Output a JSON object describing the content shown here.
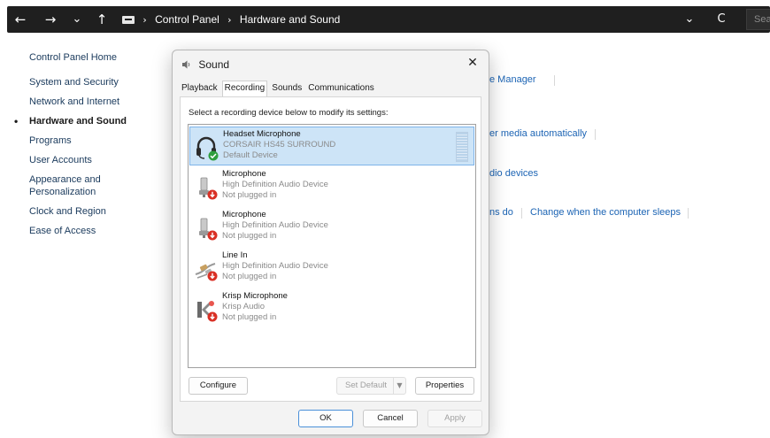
{
  "address_bar": {
    "back_icon": "←",
    "forward_icon": "→",
    "recent_icon": "⌄",
    "up_icon": "↑",
    "crumb_sep": "›",
    "crumbs": [
      "Control Panel",
      "Hardware and Sound"
    ],
    "dropdown_icon": "⌄",
    "refresh_icon": "C",
    "search_placeholder": "Search"
  },
  "sidebar": {
    "items": [
      {
        "label": "Control Panel Home"
      },
      {
        "label": "System and Security"
      },
      {
        "label": "Network and Internet"
      },
      {
        "label": "Hardware and Sound"
      },
      {
        "label": "Programs"
      },
      {
        "label": "User Accounts"
      },
      {
        "label": "Appearance and Personalization"
      },
      {
        "label": "Clock and Region"
      },
      {
        "label": "Ease of Access"
      }
    ]
  },
  "background": {
    "link1": "e Manager",
    "link2": "er media automatically",
    "link3": "dio devices",
    "link4": "ns do",
    "link5": "Change when the computer sleeps"
  },
  "dialog": {
    "title": "Sound",
    "close_label": "✕",
    "tabs": [
      {
        "label": "Playback"
      },
      {
        "label": "Recording"
      },
      {
        "label": "Sounds"
      },
      {
        "label": "Communications"
      }
    ],
    "active_tab": "Recording",
    "instruction": "Select a recording device below to modify its settings:",
    "devices": [
      {
        "name": "Headset Microphone",
        "line1": "CORSAIR HS45 SURROUND",
        "line2": "Default Device",
        "icon": "headset-icon",
        "status": "default",
        "selected": true
      },
      {
        "name": "Microphone",
        "line1": "High Definition Audio Device",
        "line2": "Not plugged in",
        "icon": "microphone-icon",
        "status": "unplugged"
      },
      {
        "name": "Microphone",
        "line1": "High Definition Audio Device",
        "line2": "Not plugged in",
        "icon": "microphone-icon",
        "status": "unplugged"
      },
      {
        "name": "Line In",
        "line1": "High Definition Audio Device",
        "line2": "Not plugged in",
        "icon": "line-in-icon",
        "status": "unplugged"
      },
      {
        "name": "Krisp Microphone",
        "line1": "Krisp Audio",
        "line2": "Not plugged in",
        "icon": "krisp-icon",
        "status": "unplugged"
      }
    ],
    "buttons": {
      "configure": "Configure",
      "set_default": "Set Default",
      "set_default_caret": "▼",
      "properties": "Properties",
      "ok": "OK",
      "cancel": "Cancel",
      "apply": "Apply"
    },
    "colors": {
      "selection": "#cde4f7",
      "selection_border": "#7eb4ea",
      "status_ok": "#2e9e3e",
      "status_unplugged": "#d93025"
    }
  }
}
